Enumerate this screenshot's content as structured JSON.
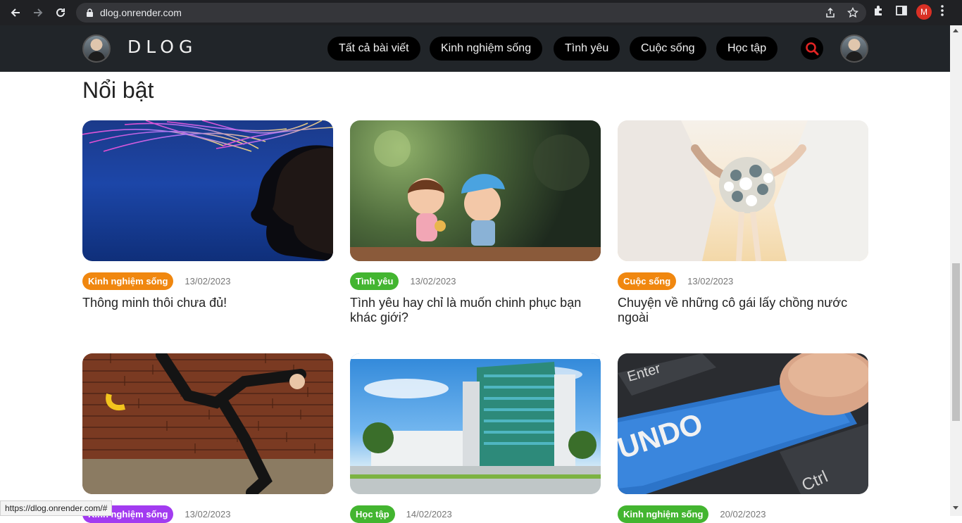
{
  "browser": {
    "url": "dlog.onrender.com",
    "profile_initial": "M",
    "status_url": "https://dlog.onrender.com/#"
  },
  "site": {
    "logo": "DLOG",
    "nav": [
      "Tất cả bài viết",
      "Kinh nghiệm sống",
      "Tình yêu",
      "Cuộc sống",
      "Học tập"
    ]
  },
  "section": {
    "title": "Nổi bật"
  },
  "posts": [
    {
      "tag": "Kinh nghiệm sống",
      "tag_color": "#f0870f",
      "date": "13/02/2023",
      "title": "Thông minh thôi chưa đủ!"
    },
    {
      "tag": "Tình yêu",
      "tag_color": "#43b530",
      "date": "13/02/2023",
      "title": "Tình yêu hay chỉ là muốn chinh phục bạn khác giới?"
    },
    {
      "tag": "Cuộc sống",
      "tag_color": "#f0870f",
      "date": "13/02/2023",
      "title": "Chuyện về những cô gái lấy chồng nước ngoài"
    },
    {
      "tag": "Kinh nghiệm sống",
      "tag_color": "#a23bf0",
      "date": "13/02/2023",
      "title": ""
    },
    {
      "tag": "Học tập",
      "tag_color": "#43b530",
      "date": "14/02/2023",
      "title": ""
    },
    {
      "tag": "Kinh nghiệm sống",
      "tag_color": "#43b530",
      "date": "20/02/2023",
      "title": ""
    }
  ],
  "image_text": {
    "keyboard_enter": "Enter",
    "keyboard_undo": "UNDO",
    "keyboard_ctrl": "Ctrl"
  }
}
